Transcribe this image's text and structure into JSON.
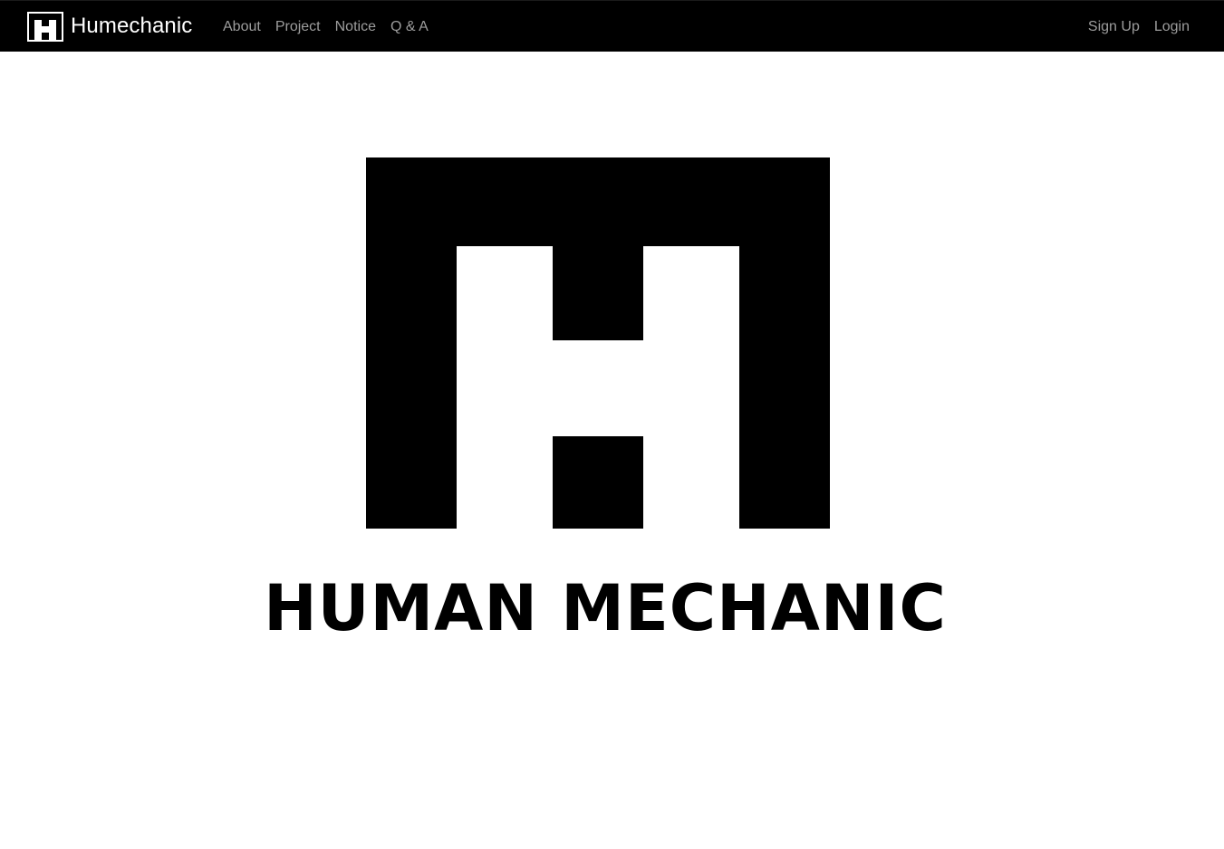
{
  "navbar": {
    "brand_name": "Humechanic",
    "brand_icon": "humechanic-h-logo-icon",
    "left_links": [
      {
        "label": "About"
      },
      {
        "label": "Project"
      },
      {
        "label": "Notice"
      },
      {
        "label": "Q & A"
      }
    ],
    "right_links": [
      {
        "label": "Sign Up"
      },
      {
        "label": "Login"
      }
    ]
  },
  "hero": {
    "logo_icon": "humechanic-h-logo-icon",
    "wordmark": "HUMAN MECHANIC"
  },
  "colors": {
    "navbar_bg": "#000000",
    "nav_link": "#9d9d9d",
    "brand_text": "#ffffff",
    "logo": "#000000",
    "page_bg": "#ffffff"
  }
}
